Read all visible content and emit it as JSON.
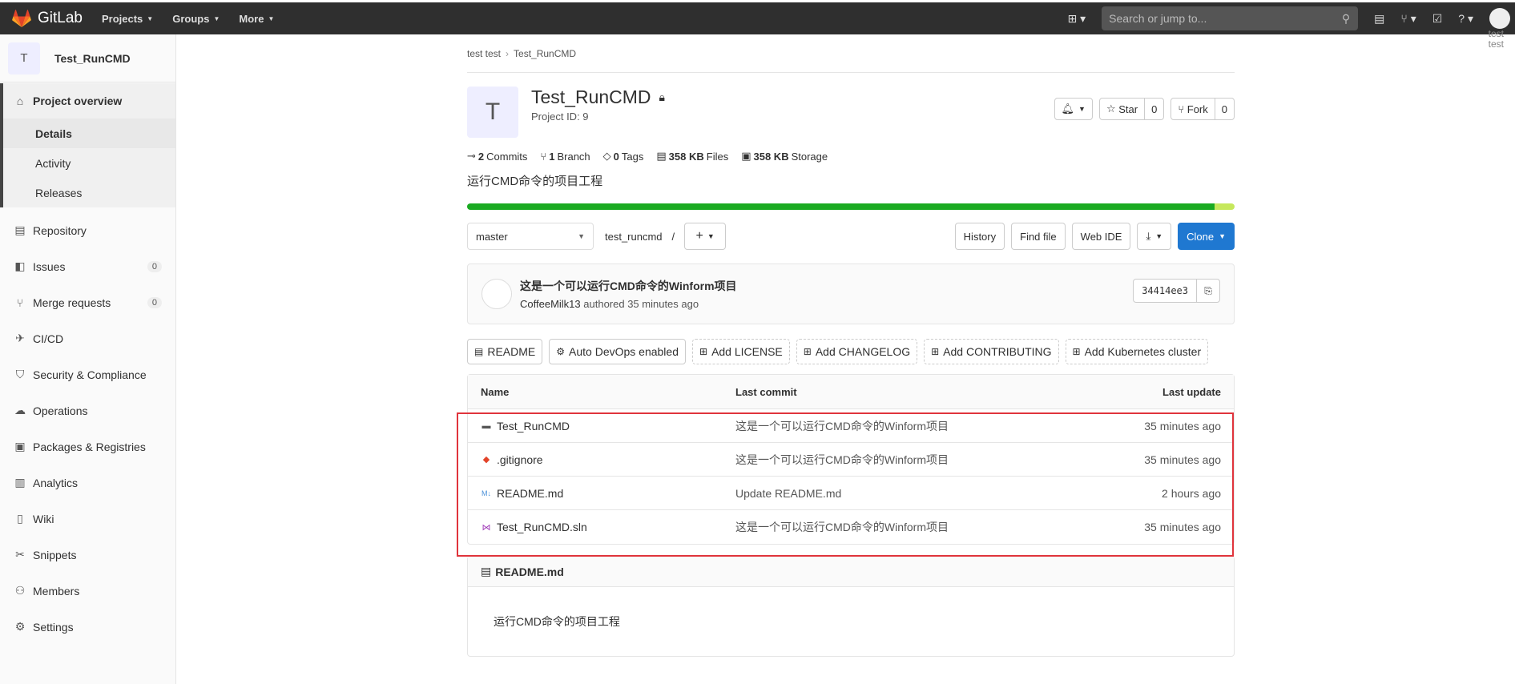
{
  "nav": {
    "brand": "GitLab",
    "projects": "Projects",
    "groups": "Groups",
    "more": "More",
    "search_placeholder": "Search or jump to...",
    "user_label": "test"
  },
  "sidebar": {
    "project_initial": "T",
    "project_name": "Test_RunCMD",
    "overview": "Project overview",
    "overview_sub": [
      "Details",
      "Activity",
      "Releases"
    ],
    "items": [
      {
        "label": "Repository"
      },
      {
        "label": "Issues",
        "badge": "0"
      },
      {
        "label": "Merge requests",
        "badge": "0"
      },
      {
        "label": "CI/CD"
      },
      {
        "label": "Security & Compliance"
      },
      {
        "label": "Operations"
      },
      {
        "label": "Packages & Registries"
      },
      {
        "label": "Analytics"
      },
      {
        "label": "Wiki"
      },
      {
        "label": "Snippets"
      },
      {
        "label": "Members"
      },
      {
        "label": "Settings"
      }
    ]
  },
  "breadcrumb": [
    "test test",
    "Test_RunCMD"
  ],
  "project": {
    "initial": "T",
    "name": "Test_RunCMD",
    "id_label": "Project ID: 9",
    "star": "Star",
    "star_count": "0",
    "fork": "Fork",
    "fork_count": "0",
    "stats": {
      "commits_n": "2",
      "commits": "Commits",
      "branch_n": "1",
      "branch": "Branch",
      "tags_n": "0",
      "tags": "Tags",
      "files_n": "358 KB",
      "files": "Files",
      "storage_n": "358 KB",
      "storage": "Storage"
    },
    "description": "运行CMD命令的项目工程",
    "lang_primary_fraction": 0.974
  },
  "toolbar": {
    "branch": "master",
    "path": "test_runcmd",
    "slash": "/",
    "history": "History",
    "find_file": "Find file",
    "web_ide": "Web IDE",
    "clone": "Clone"
  },
  "commit": {
    "message": "这是一个可以运行CMD命令的Winform项目",
    "author": "CoffeeMilk13",
    "meta": "authored 35 minutes ago",
    "sha": "34414ee3"
  },
  "chips": [
    "README",
    "Auto DevOps enabled",
    "Add LICENSE",
    "Add CHANGELOG",
    "Add CONTRIBUTING",
    "Add Kubernetes cluster"
  ],
  "files": {
    "headers": [
      "Name",
      "Last commit",
      "Last update"
    ],
    "rows": [
      {
        "name": "Test_RunCMD",
        "commit": "这是一个可以运行CMD命令的Winform项目",
        "updated": "35 minutes ago"
      },
      {
        "name": ".gitignore",
        "commit": "这是一个可以运行CMD命令的Winform项目",
        "updated": "35 minutes ago"
      },
      {
        "name": "README.md",
        "commit": "Update README.md",
        "updated": "2 hours ago"
      },
      {
        "name": "Test_RunCMD.sln",
        "commit": "这是一个可以运行CMD命令的Winform项目",
        "updated": "35 minutes ago"
      }
    ]
  },
  "readme": {
    "title": "README.md",
    "body": "运行CMD命令的项目工程"
  },
  "colors": {
    "clone": "#1f78d1",
    "highlight": "#e0343c",
    "lang_primary": "#1aaa22",
    "lang_secondary": "#c6e85c"
  }
}
